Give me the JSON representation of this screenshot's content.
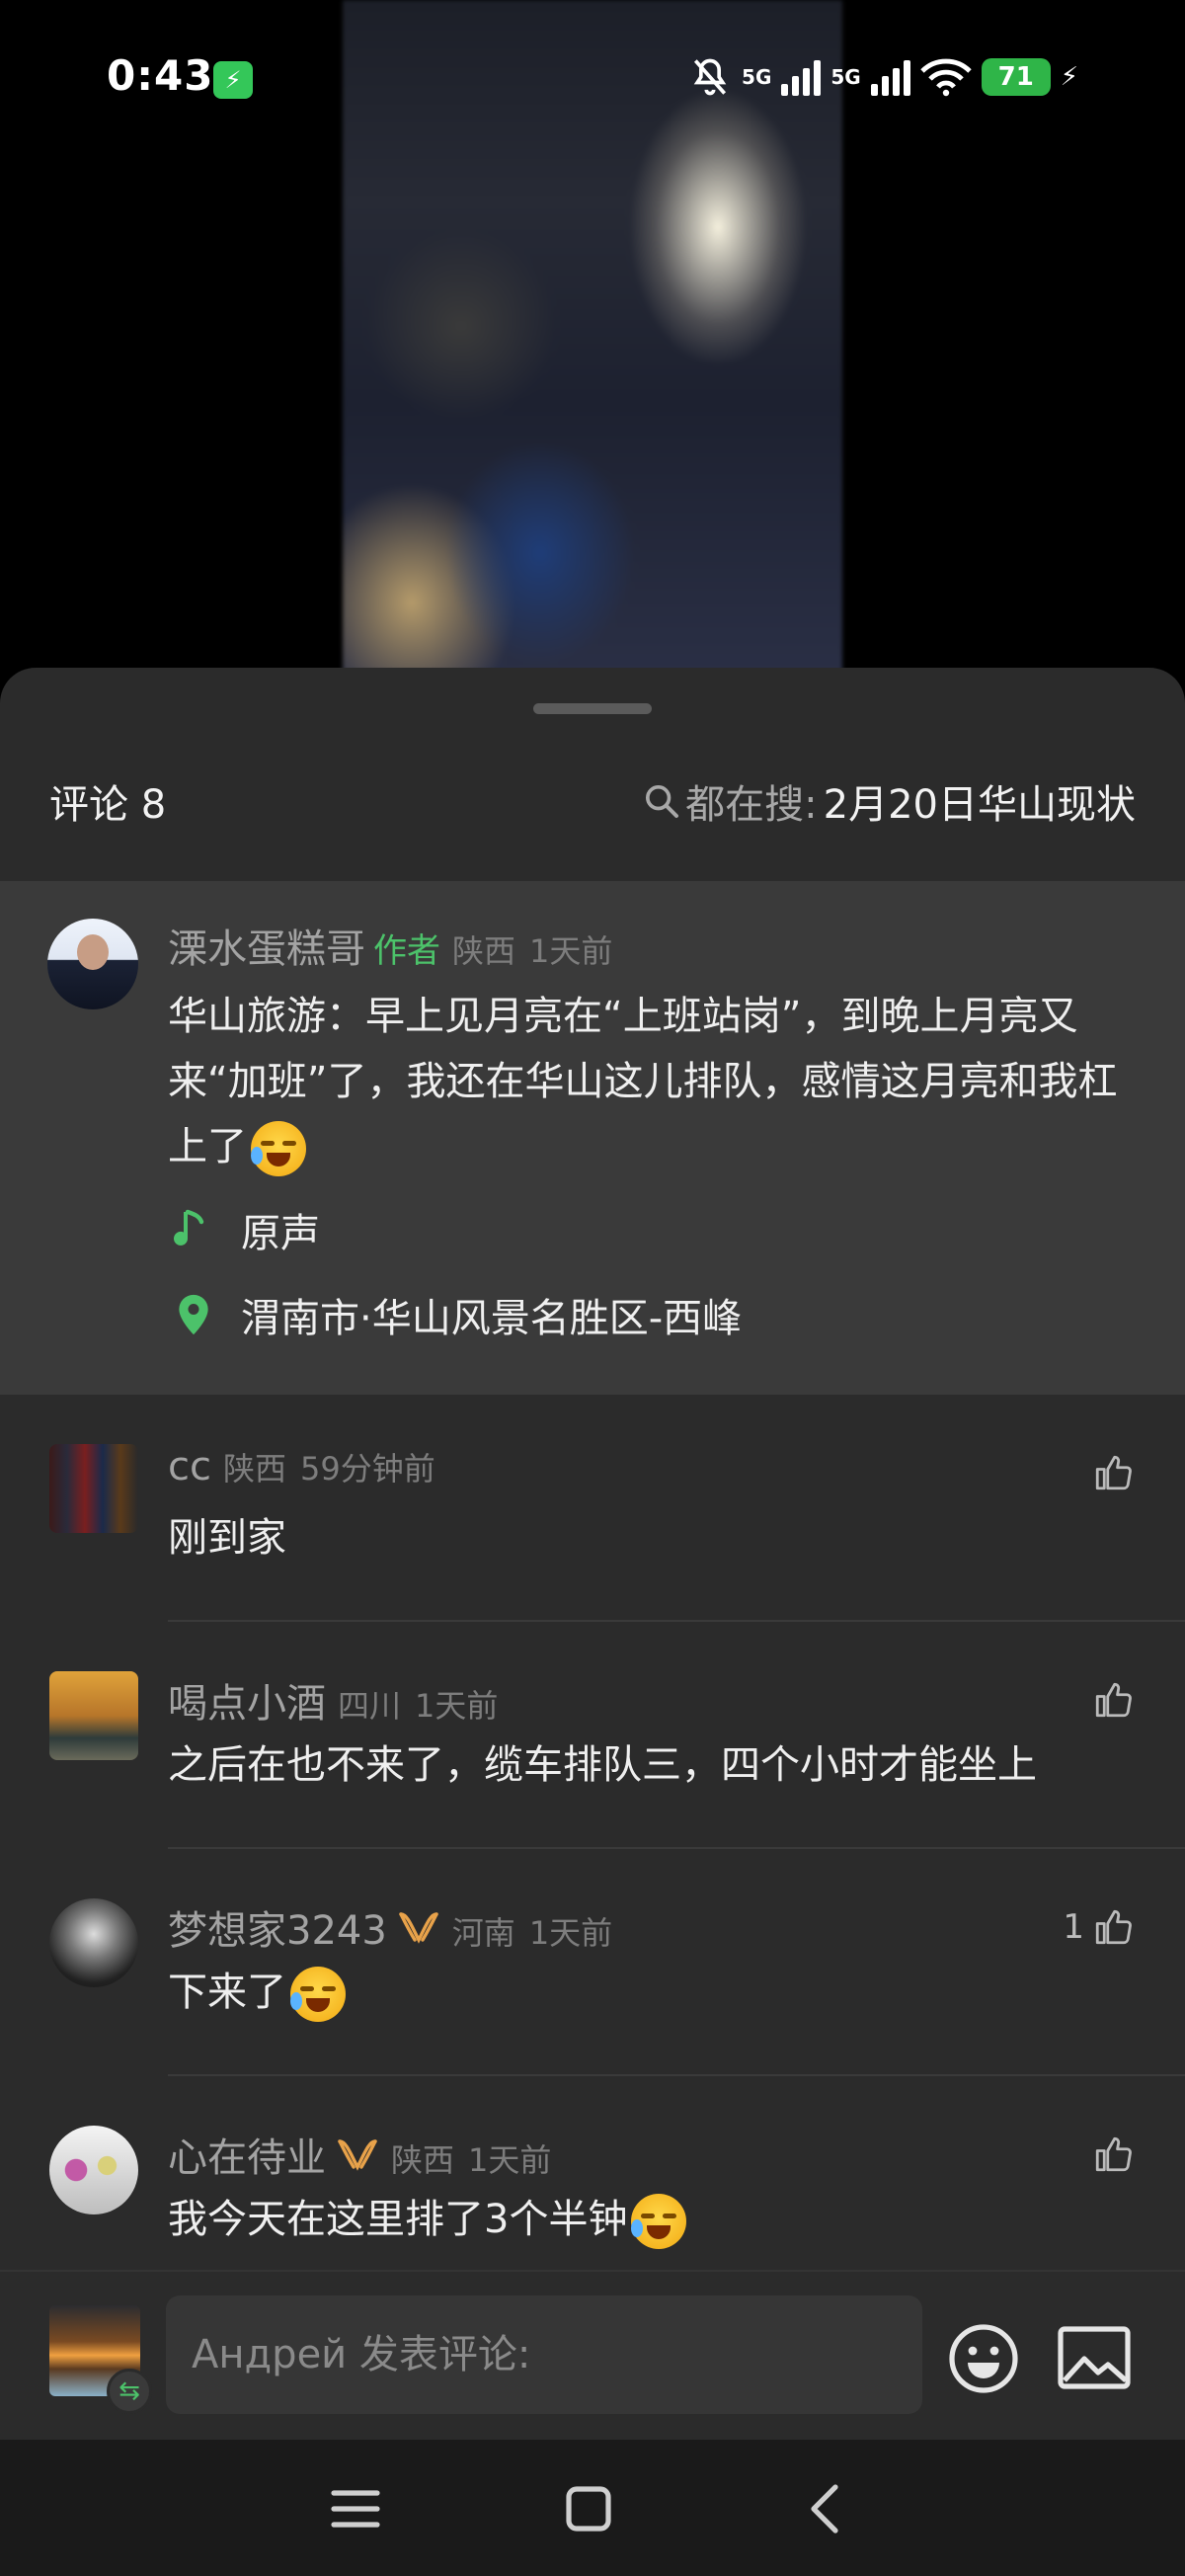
{
  "status_bar": {
    "time": "0:43",
    "charge_icon": "⚡",
    "sig1": "5G",
    "sig2": "5G",
    "battery": "71",
    "charging_glyph": "⚡"
  },
  "comments_sheet": {
    "title": "评论 8",
    "search_lead": "都在搜:",
    "search_term": "2月20日华山现状"
  },
  "author_post": {
    "nickname": "溧水蛋糕哥",
    "tag": "作者",
    "region": "陕西",
    "time": "1天前",
    "text": "华山旅游：早上见月亮在“上班站岗”，到晚上月亮又来“加班”了，我还在华山这儿排队，感情这月亮和我杠上了",
    "music": "原声",
    "location": "渭南市·华山风景名胜区-西峰"
  },
  "comments": [
    {
      "nickname": "cc",
      "region": "陕西",
      "time": "59分钟前",
      "text": "刚到家",
      "likes": ""
    },
    {
      "nickname": "喝点小酒",
      "region": "四川",
      "time": "1天前",
      "text": "之后在也不来了，缆车排队三，四个小时才能坐上",
      "likes": ""
    },
    {
      "nickname": "梦想家3243",
      "region": "河南",
      "time": "1天前",
      "text": "下来了",
      "likes": "1"
    },
    {
      "nickname": "心在待业",
      "region": "陕西",
      "time": "1天前",
      "text": "我今天在这里排了3个半钟",
      "likes": ""
    }
  ],
  "input_bar": {
    "placeholder": "Андрей 发表评论:",
    "switch_glyph": "⇆"
  },
  "colors": {
    "sheet_bg": "#2b2b2b",
    "author_bg": "#3a3a3a",
    "accent_green": "#4cc26a",
    "vip_orange": "#e8a24a"
  }
}
